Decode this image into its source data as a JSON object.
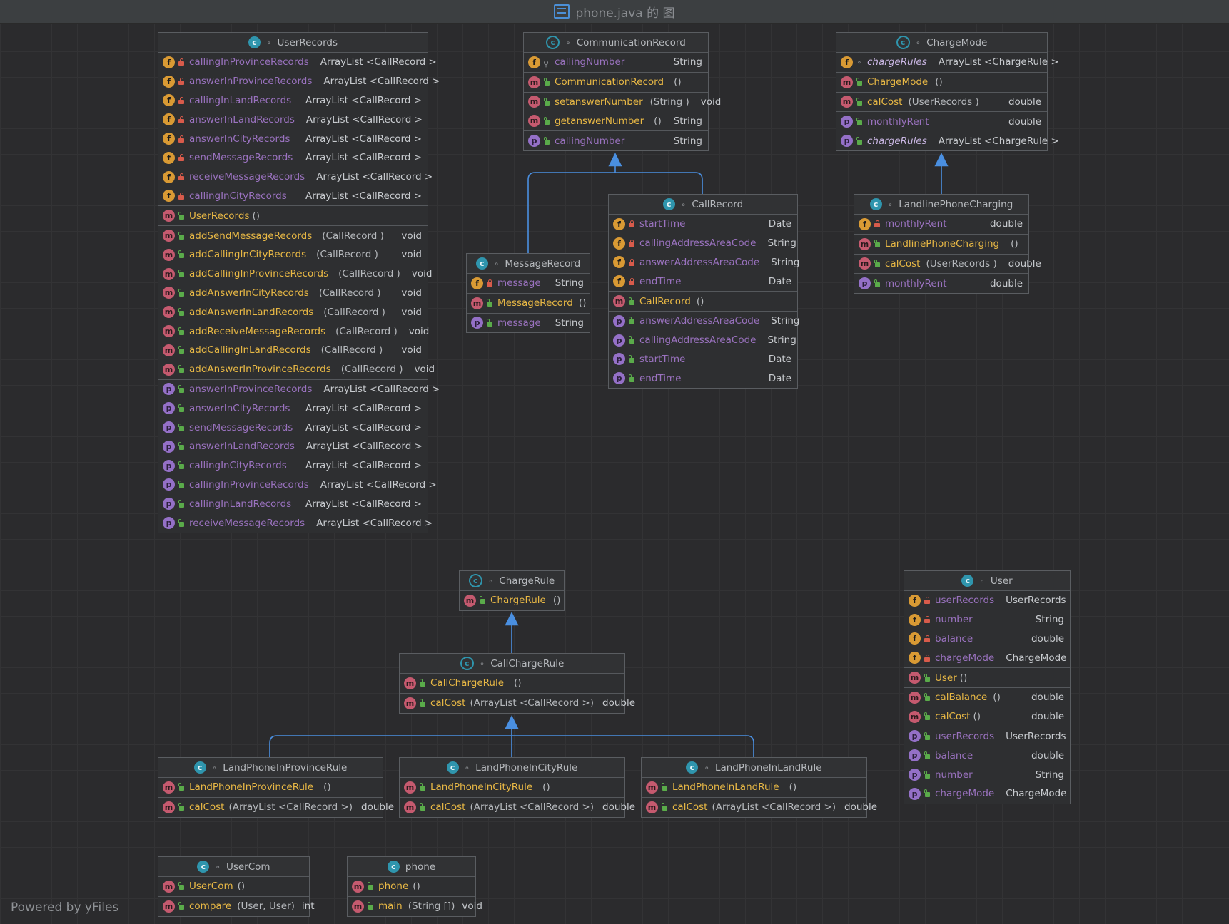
{
  "window": {
    "title": "phone.java 的 图"
  },
  "footer": {
    "powered_by": "Powered by yFiles"
  },
  "colors": {
    "field_badge": "#d99a34",
    "method_badge": "#c55a6f",
    "property_badge": "#9470c7",
    "class_badge": "#2f95ad",
    "method_name": "#e8b845",
    "field_name": "#9a72bf",
    "inheritance_edge": "#4a8fe0"
  },
  "nodes": {
    "UserRecords": {
      "name": "UserRecords",
      "fields": [
        {
          "name": "callingInProvinceRecords",
          "type": "ArrayList <CallRecord >"
        },
        {
          "name": "answerInProvinceRecords",
          "type": "ArrayList <CallRecord >"
        },
        {
          "name": "callingInLandRecords",
          "type": "ArrayList <CallRecord >"
        },
        {
          "name": "answerInLandRecords",
          "type": "ArrayList <CallRecord >"
        },
        {
          "name": "answerInCityRecords",
          "type": "ArrayList <CallRecord >"
        },
        {
          "name": "sendMessageRecords",
          "type": "ArrayList <CallRecord >"
        },
        {
          "name": "receiveMessageRecords",
          "type": "ArrayList <CallRecord >"
        },
        {
          "name": "callingInCityRecords",
          "type": "ArrayList <CallRecord >"
        }
      ],
      "constructors": [
        {
          "name": "UserRecords",
          "params": "()",
          "type": ""
        }
      ],
      "methods": [
        {
          "name": "addSendMessageRecords",
          "params": "(CallRecord )",
          "type": "void"
        },
        {
          "name": "addCallingInCityRecords",
          "params": "(CallRecord )",
          "type": "void"
        },
        {
          "name": "addCallingInProvinceRecords",
          "params": "(CallRecord )",
          "type": "void"
        },
        {
          "name": "addAnswerInCityRecords",
          "params": "(CallRecord )",
          "type": "void"
        },
        {
          "name": "addAnswerInLandRecords",
          "params": "(CallRecord )",
          "type": "void"
        },
        {
          "name": "addReceiveMessageRecords",
          "params": "(CallRecord )",
          "type": "void"
        },
        {
          "name": "addCallingInLandRecords",
          "params": "(CallRecord )",
          "type": "void"
        },
        {
          "name": "addAnswerInProvinceRecords",
          "params": "(CallRecord )",
          "type": "void"
        }
      ],
      "properties": [
        {
          "name": "answerInProvinceRecords",
          "type": "ArrayList <CallRecord >"
        },
        {
          "name": "answerInCityRecords",
          "type": "ArrayList <CallRecord >"
        },
        {
          "name": "sendMessageRecords",
          "type": "ArrayList <CallRecord >"
        },
        {
          "name": "answerInLandRecords",
          "type": "ArrayList <CallRecord >"
        },
        {
          "name": "callingInCityRecords",
          "type": "ArrayList <CallRecord >"
        },
        {
          "name": "callingInProvinceRecords",
          "type": "ArrayList <CallRecord >"
        },
        {
          "name": "callingInLandRecords",
          "type": "ArrayList <CallRecord >"
        },
        {
          "name": "receiveMessageRecords",
          "type": "ArrayList <CallRecord >"
        }
      ]
    },
    "CommunicationRecord": {
      "name": "CommunicationRecord",
      "fields": [
        {
          "name": "callingNumber",
          "type": "String"
        }
      ],
      "constructors": [
        {
          "name": "CommunicationRecord",
          "params": "()",
          "type": ""
        }
      ],
      "methods": [
        {
          "name": "setanswerNumber",
          "params": "(String )",
          "type": "void"
        },
        {
          "name": "getanswerNumber",
          "params": "()",
          "type": "String"
        }
      ],
      "properties": [
        {
          "name": "callingNumber",
          "type": "String"
        }
      ]
    },
    "ChargeMode": {
      "name": "ChargeMode",
      "fields": [
        {
          "name": "chargeRules",
          "type": "ArrayList <ChargeRule >"
        }
      ],
      "constructors": [
        {
          "name": "ChargeMode",
          "params": "()",
          "type": ""
        }
      ],
      "methods": [
        {
          "name": "calCost",
          "params": "(UserRecords )",
          "type": "double"
        }
      ],
      "properties": [
        {
          "name": "monthlyRent",
          "type": "double"
        },
        {
          "name": "chargeRules",
          "type": "ArrayList <ChargeRule >"
        }
      ]
    },
    "CallRecord": {
      "name": "CallRecord",
      "fields": [
        {
          "name": "startTime",
          "type": "Date"
        },
        {
          "name": "callingAddressAreaCode",
          "type": "String"
        },
        {
          "name": "answerAddressAreaCode",
          "type": "String"
        },
        {
          "name": "endTime",
          "type": "Date"
        }
      ],
      "constructors": [
        {
          "name": "CallRecord",
          "params": "()",
          "type": ""
        }
      ],
      "properties": [
        {
          "name": "answerAddressAreaCode",
          "type": "String"
        },
        {
          "name": "callingAddressAreaCode",
          "type": "String"
        },
        {
          "name": "startTime",
          "type": "Date"
        },
        {
          "name": "endTime",
          "type": "Date"
        }
      ]
    },
    "MessageRecord": {
      "name": "MessageRecord",
      "fields": [
        {
          "name": "message",
          "type": "String"
        }
      ],
      "constructors": [
        {
          "name": "MessageRecord",
          "params": "()",
          "type": ""
        }
      ],
      "properties": [
        {
          "name": "message",
          "type": "String"
        }
      ]
    },
    "LandlinePhoneCharging": {
      "name": "LandlinePhoneCharging",
      "fields": [
        {
          "name": "monthlyRent",
          "type": "double"
        }
      ],
      "constructors": [
        {
          "name": "LandlinePhoneCharging",
          "params": "()",
          "type": ""
        }
      ],
      "methods": [
        {
          "name": "calCost",
          "params": "(UserRecords )",
          "type": "double"
        }
      ],
      "properties": [
        {
          "name": "monthlyRent",
          "type": "double"
        }
      ]
    },
    "ChargeRule": {
      "name": "ChargeRule",
      "constructors": [
        {
          "name": "ChargeRule",
          "params": "()",
          "type": ""
        }
      ]
    },
    "CallChargeRule": {
      "name": "CallChargeRule",
      "constructors": [
        {
          "name": "CallChargeRule",
          "params": "()",
          "type": ""
        }
      ],
      "methods": [
        {
          "name": "calCost",
          "params": "(ArrayList <CallRecord >)",
          "type": "double"
        }
      ]
    },
    "User": {
      "name": "User",
      "fields": [
        {
          "name": "userRecords",
          "type": "UserRecords"
        },
        {
          "name": "number",
          "type": "String"
        },
        {
          "name": "balance",
          "type": "double"
        },
        {
          "name": "chargeMode",
          "type": "ChargeMode"
        }
      ],
      "constructors": [
        {
          "name": "User",
          "params": "()",
          "type": ""
        }
      ],
      "methods": [
        {
          "name": "calBalance",
          "params": "()",
          "type": "double"
        },
        {
          "name": "calCost",
          "params": "()",
          "type": "double"
        }
      ],
      "properties": [
        {
          "name": "userRecords",
          "type": "UserRecords"
        },
        {
          "name": "balance",
          "type": "double"
        },
        {
          "name": "number",
          "type": "String"
        },
        {
          "name": "chargeMode",
          "type": "ChargeMode"
        }
      ]
    },
    "LandPhoneInProvinceRule": {
      "name": "LandPhoneInProvinceRule",
      "constructors": [
        {
          "name": "LandPhoneInProvinceRule",
          "params": "()",
          "type": ""
        }
      ],
      "methods": [
        {
          "name": "calCost",
          "params": "(ArrayList <CallRecord >)",
          "type": "double"
        }
      ]
    },
    "LandPhoneInCityRule": {
      "name": "LandPhoneInCityRule",
      "constructors": [
        {
          "name": "LandPhoneInCityRule",
          "params": "()",
          "type": ""
        }
      ],
      "methods": [
        {
          "name": "calCost",
          "params": "(ArrayList <CallRecord >)",
          "type": "double"
        }
      ]
    },
    "LandPhoneInLandRule": {
      "name": "LandPhoneInLandRule",
      "constructors": [
        {
          "name": "LandPhoneInLandRule",
          "params": "()",
          "type": ""
        }
      ],
      "methods": [
        {
          "name": "calCost",
          "params": "(ArrayList <CallRecord >)",
          "type": "double"
        }
      ]
    },
    "UserCom": {
      "name": "UserCom",
      "constructors": [
        {
          "name": "UserCom",
          "params": "()",
          "type": ""
        }
      ],
      "methods": [
        {
          "name": "compare",
          "params": "(User, User)",
          "type": "int"
        }
      ]
    },
    "phone": {
      "name": "phone",
      "constructors": [
        {
          "name": "phone",
          "params": "()",
          "type": ""
        }
      ],
      "methods": [
        {
          "name": "main",
          "params": "(String [])",
          "type": "void"
        }
      ]
    }
  }
}
